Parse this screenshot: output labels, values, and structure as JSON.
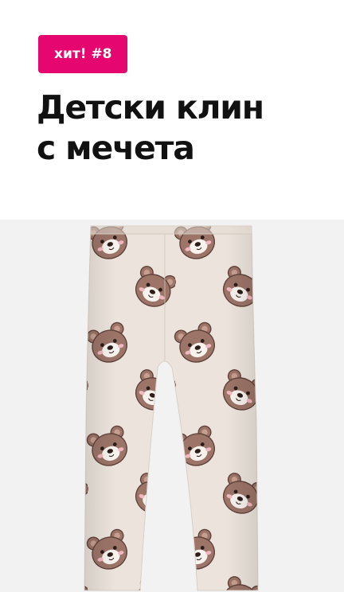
{
  "badge": {
    "label": "хит! #8"
  },
  "title": {
    "line1": "Детски клин",
    "line2": "с мечета"
  },
  "product_image": {
    "subject": "leggings-with-bear-print",
    "fabric_color": "#ece4dc",
    "bear_color": "#9c7468",
    "bear_muzzle_color": "#f7f2ee",
    "cheek_color": "#f2b8c0"
  },
  "colors": {
    "accent": "#e6066f",
    "text": "#111111",
    "image_background": "#f2f2f2"
  }
}
